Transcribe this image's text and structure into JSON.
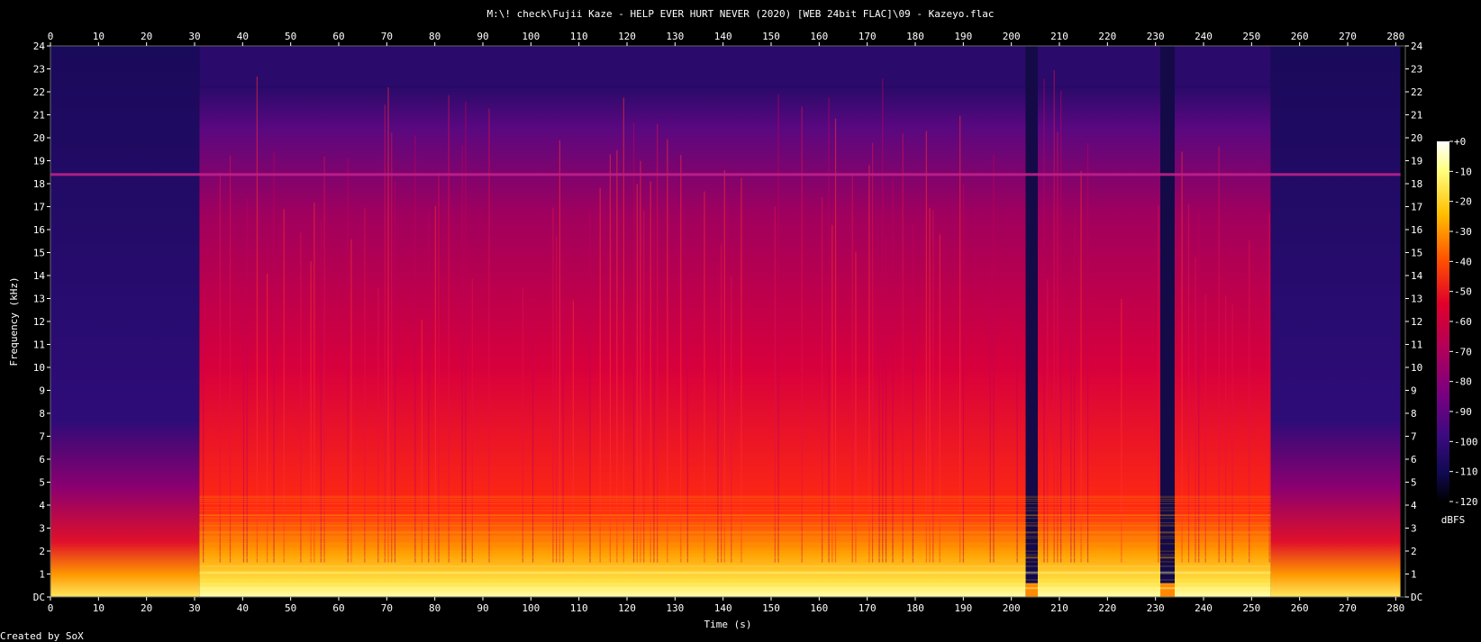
{
  "title": "M:\\! check\\Fujii Kaze - HELP EVER HURT NEVER (2020) [WEB 24bit FLAC]\\09 - Kazeyo.flac",
  "footer": "Created by SoX",
  "colors": {
    "background": "#000000",
    "noise_floor": "#1a0a5a",
    "mid": "#b0005a",
    "loud": "#ff3a00",
    "peak": "#ffff90"
  },
  "chart_data": {
    "type": "heatmap",
    "subtype": "spectrogram",
    "xlabel": "Time (s)",
    "ylabel": "Frequency (kHz)",
    "x_ticks": [
      0,
      10,
      20,
      30,
      40,
      50,
      60,
      70,
      80,
      90,
      100,
      110,
      120,
      130,
      140,
      150,
      160,
      170,
      180,
      190,
      200,
      210,
      220,
      230,
      240,
      250,
      260,
      270,
      280
    ],
    "y_ticks": [
      "DC",
      "1",
      "2",
      "3",
      "4",
      "5",
      "6",
      "7",
      "8",
      "9",
      "10",
      "11",
      "12",
      "13",
      "14",
      "15",
      "16",
      "17",
      "18",
      "19",
      "20",
      "21",
      "22",
      "23",
      "24"
    ],
    "xlim": [
      0,
      282
    ],
    "ylim": [
      0,
      24
    ],
    "colorbar": {
      "label": "dBFS",
      "ticks": [
        "+0",
        "-10",
        "-20",
        "-30",
        "-40",
        "-50",
        "-60",
        "-70",
        "-80",
        "-90",
        "-100",
        "-110",
        "-120"
      ],
      "range": [
        -120,
        0
      ]
    },
    "duration_s": 281,
    "features": {
      "quiet_intro_end_s": 31,
      "dropout_segments_s": [
        [
          203,
          205.5
        ],
        [
          231,
          234
        ]
      ],
      "tone_line_khz": 18.4,
      "fade_out_start_s": 254
    }
  }
}
